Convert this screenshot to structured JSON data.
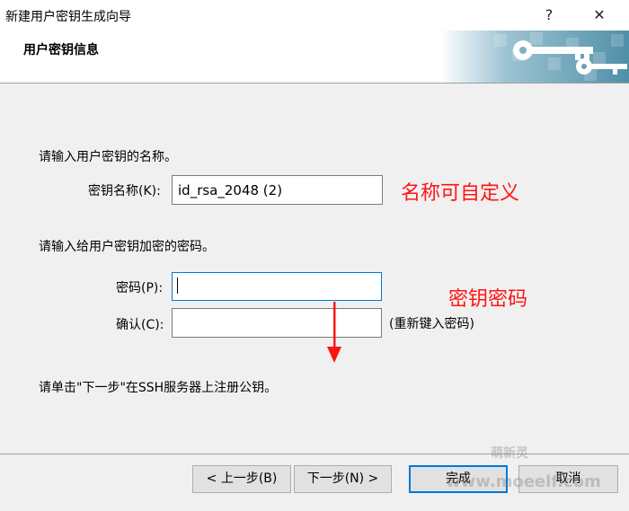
{
  "window": {
    "title": "新建用户密钥生成向导",
    "help_glyph": "?",
    "close_glyph": "✕"
  },
  "header": {
    "heading": "用户密钥信息",
    "banner_icon": "key-icon"
  },
  "form": {
    "name_prompt": "请输入用户密钥的名称。",
    "key_name_label": "密钥名称(K):",
    "key_name_value": "id_rsa_2048 (2)",
    "password_prompt": "请输入给用户密钥加密的密码。",
    "password_label": "密码(P):",
    "password_value": "",
    "confirm_label": "确认(C):",
    "confirm_value": "",
    "confirm_hint": "(重新键入密码)",
    "register_note": "请单击\"下一步\"在SSH服务器上注册公钥。"
  },
  "annotations": {
    "name_note": "名称可自定义",
    "password_note": "密钥密码",
    "color": "#ff1414"
  },
  "buttons": {
    "back": "< 上一步(B)",
    "next": "下一步(N) >",
    "finish": "完成",
    "cancel": "取消"
  },
  "watermark": {
    "top": "萌新灵",
    "bottom": "www.moeelf.com"
  },
  "colors": {
    "accent": "#0078d7",
    "dialog_bg": "#f0f0f0",
    "banner": "#4f8fa8"
  }
}
